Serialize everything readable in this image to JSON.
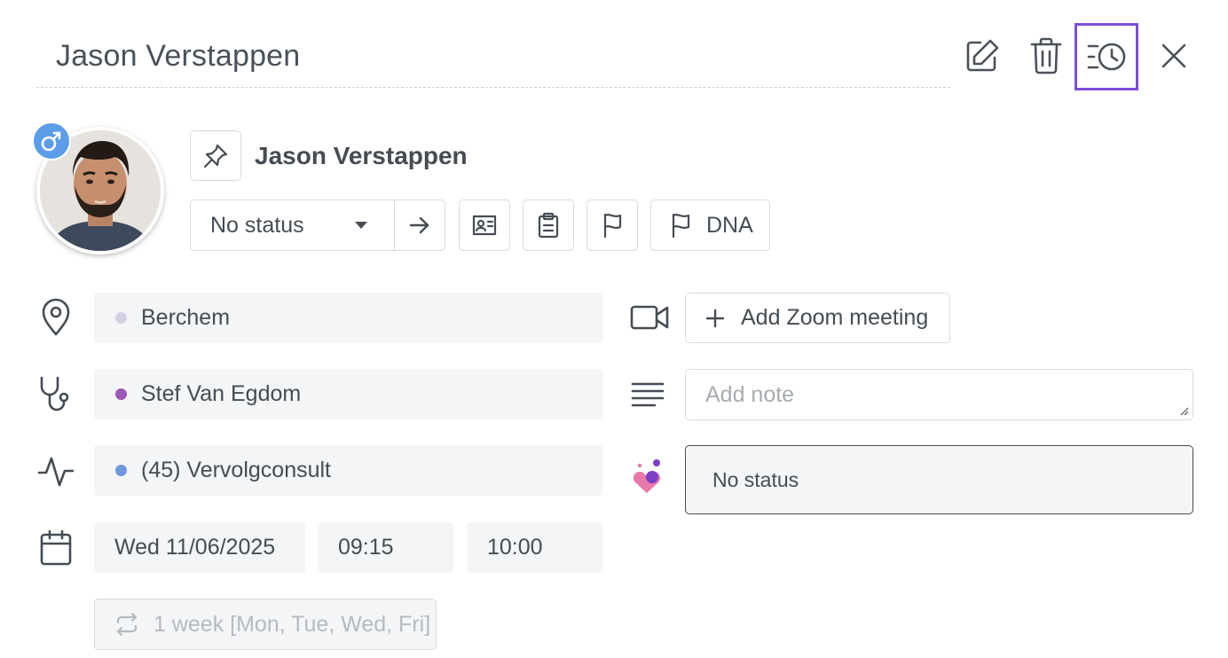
{
  "header": {
    "title": "Jason Verstappen",
    "actions": [
      {
        "name": "edit",
        "icon": "edit-icon"
      },
      {
        "name": "delete",
        "icon": "trash-icon"
      },
      {
        "name": "history",
        "icon": "history-icon",
        "highlighted": true
      },
      {
        "name": "close",
        "icon": "close-icon"
      }
    ]
  },
  "patient": {
    "name": "Jason Verstappen",
    "gender_icon": "male-icon",
    "avatar": "avatar-photo"
  },
  "status": {
    "selected": "No status",
    "next_icon": "arrow-right-icon"
  },
  "quick_buttons": [
    {
      "icon": "contact-card-icon"
    },
    {
      "icon": "clipboard-icon"
    },
    {
      "icon": "flag-icon"
    },
    {
      "icon": "flag-icon",
      "label": "DNA"
    }
  ],
  "details": {
    "location": {
      "icon": "location-pin-icon",
      "value": "Berchem",
      "dot_color": "#d5d1e3"
    },
    "practitioner": {
      "icon": "stethoscope-icon",
      "value": "Stef Van Egdom",
      "dot_color": "#9b59b6"
    },
    "appointment_type": {
      "icon": "activity-icon",
      "value": "(45) Vervolgconsult",
      "dot_color": "#6f97e0"
    },
    "date": {
      "icon": "calendar-icon",
      "day": "Wed 11/06/2025",
      "start": "09:15",
      "end": "10:00"
    },
    "recurrence": {
      "icon": "repeat-icon",
      "value": "1 week [Mon, Tue, Wed, Fri]"
    }
  },
  "right_panel": {
    "zoom": {
      "icon": "video-camera-icon",
      "label": "Add Zoom meeting"
    },
    "note": {
      "icon": "text-lines-icon",
      "placeholder": "Add note"
    },
    "external_status": {
      "icon": "heart-logo-icon",
      "value": "No status"
    }
  },
  "colors": {
    "highlight": "#7c4ddb",
    "gender_badge": "#5b9de8",
    "text": "#454c54",
    "field_bg": "#f4f5f6"
  }
}
